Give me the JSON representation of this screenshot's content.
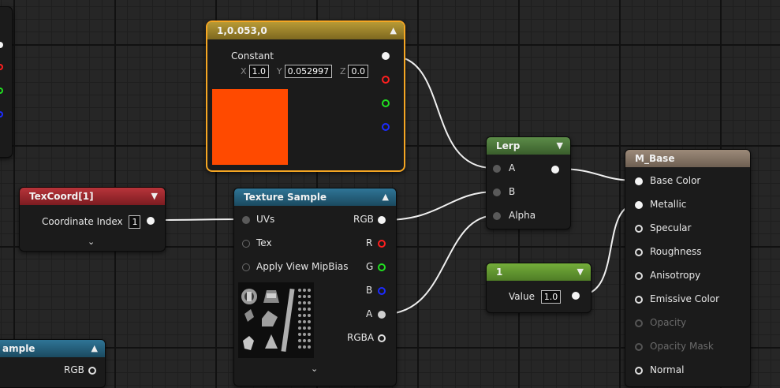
{
  "colors": {
    "constant_header": "#a58a2a",
    "lerp_header": "#4b7a3a",
    "mbase_header": "#8e7c6c",
    "texcoord_header": "#a0262b",
    "texture_header": "#26627e",
    "const1_header": "#66a032",
    "constant_swatch": "#ff4a00",
    "selection_outline": "#f5a623"
  },
  "constant_node": {
    "title": "1,0.053,0",
    "label": "Constant",
    "x_label": "X",
    "x_value": "1.0",
    "y_label": "Y",
    "y_value": "0.052997",
    "z_label": "Z",
    "z_value": "0.0",
    "collapse_icon": "chevron-up-icon"
  },
  "lerp_node": {
    "title": "Lerp",
    "inputs": [
      "A",
      "B",
      "Alpha"
    ],
    "collapse_icon": "chevron-down-icon"
  },
  "mbase_node": {
    "title": "M_Base",
    "inputs": [
      "Base Color",
      "Metallic",
      "Specular",
      "Roughness",
      "Anisotropy",
      "Emissive Color",
      "Opacity",
      "Opacity Mask",
      "Normal"
    ]
  },
  "texcoord_node": {
    "title": "TexCoord[1]",
    "label": "Coordinate Index",
    "value": "1",
    "expand_icon": "chevron-down-icon"
  },
  "texture_node": {
    "title": "Texture Sample",
    "inputs": [
      "UVs",
      "Tex",
      "Apply View MipBias"
    ],
    "outputs": [
      "RGB",
      "R",
      "G",
      "B",
      "A",
      "RGBA"
    ],
    "expand_icon": "chevron-down-icon"
  },
  "constant1_node": {
    "title": "1",
    "label": "Value",
    "value": "1.0"
  },
  "partial_texture_node": {
    "title": "ample",
    "output": "RGB"
  }
}
